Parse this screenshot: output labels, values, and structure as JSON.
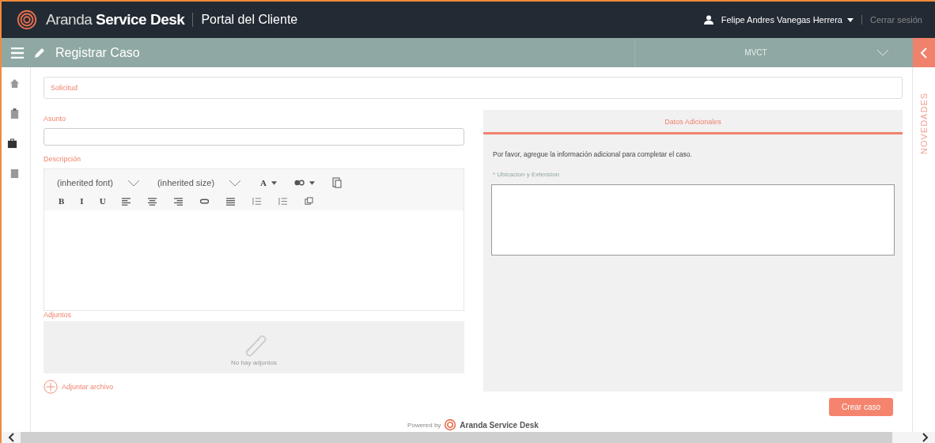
{
  "header": {
    "brand_light": "Aranda",
    "brand_bold": "Service Desk",
    "portal": "Portal del Cliente",
    "user": "Felipe Andres Vanegas Herrera",
    "logout": "Cerrar sesión"
  },
  "toolbar": {
    "title": "Registrar Caso",
    "project": "MVCT"
  },
  "sidebar": {
    "items": [
      {
        "selected": false
      },
      {
        "selected": false
      },
      {
        "selected": true
      },
      {
        "selected": false
      }
    ]
  },
  "form": {
    "type_placeholder": "Solicitud",
    "subject_label": "Asunto",
    "description_label": "Descripción",
    "font_select": "(inherited font)",
    "size_select": "(inherited size)",
    "format_buttons": [
      "B",
      "I",
      "U"
    ],
    "color_letter": "A",
    "attachments_label": "Adjuntos",
    "no_attachments": "No hay adjuntos",
    "attach_link": "Adjuntar archivo"
  },
  "additional": {
    "tab": "Datos Adicionales",
    "intro": "Por favor, agregue la información adicional para completar el caso.",
    "field_label": "* Ubicacion y Extension"
  },
  "submit": "Crear caso",
  "footer": {
    "powered": "Powered by",
    "brand": "Aranda Service Desk"
  },
  "news_tab": "NOVEDADES"
}
